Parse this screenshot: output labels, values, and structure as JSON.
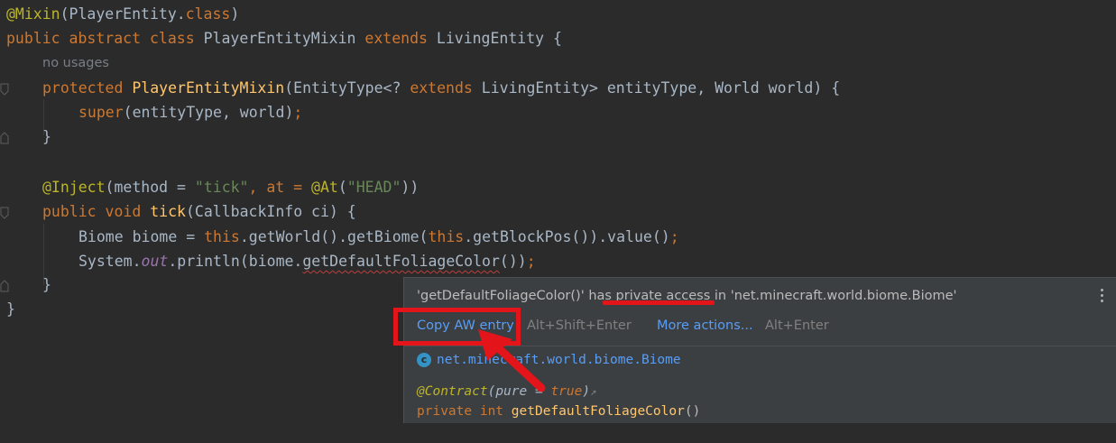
{
  "code": {
    "mixin_annotation": "@Mixin",
    "mixin_arg": "(PlayerEntity.",
    "mixin_class_kw": "class",
    "mixin_close": ")",
    "kw_public": "public",
    "kw_abstract": "abstract",
    "kw_class": "class",
    "class_name": "PlayerEntityMixin",
    "kw_extends": "extends",
    "parent_class": "LivingEntity {",
    "usages_hint": "no usages",
    "kw_protected": "protected",
    "ctor_name": "PlayerEntityMixin",
    "ctor_params_open": "(EntityType<? ",
    "ctor_kw_extends": "extends",
    "ctor_params_rest": " LivingEntity> entityType, World world) {",
    "kw_super": "super",
    "super_args": "(entityType, world)",
    "semicolon": ";",
    "close_brace": "}",
    "inject_annotation": "@Inject",
    "inject_open": "(method = ",
    "inject_method": "\"tick\"",
    "inject_comma": ", at = ",
    "at_annotation": "@At",
    "at_open": "(",
    "at_value": "\"HEAD\"",
    "at_close": "))",
    "kw_public2": "public",
    "kw_void": "void",
    "method_name": "tick",
    "method_params": "(CallbackInfo ci) {",
    "biome_decl": "Biome biome = ",
    "kw_this": "this",
    "get_world": ".getWorld().getBiome(",
    "kw_this2": "this",
    "get_block_pos": ".getBlockPos()).value()",
    "system": "System.",
    "out_field": "out",
    "println_open": ".println(biome.",
    "foliage_call": "getDefaultFoliageColor",
    "println_close": "())",
    "method_close": "}",
    "class_close": "}"
  },
  "popup": {
    "message_prefix": "'getDefaultFoliageColor()' ",
    "message_has": "has private access",
    "message_suffix": " in 'net.minecraft.world.biome.Biome'",
    "action_primary": "Copy AW entry",
    "action_primary_shortcut": "Alt+Shift+Enter",
    "action_more": "More actions...",
    "action_more_shortcut": "Alt+Enter",
    "class_badge": "c",
    "class_fqn": "net.minecraft.world.biome.Biome",
    "contract_annotation": "@Contract",
    "contract_open": "(",
    "contract_param": "pure",
    "contract_eq": " = ",
    "contract_value": "true",
    "contract_close": ")",
    "contract_arrow": "↗",
    "signature_private": "private",
    "signature_int": "int",
    "signature_name": "getDefaultFoliageColor",
    "signature_parens": "()"
  },
  "colors": {
    "editor_bg": "#2b2b2b",
    "popup_bg": "#3c3f41",
    "keyword": "#cc7832",
    "annotation": "#bbb529",
    "function": "#ffc66d",
    "string": "#6a8759",
    "link": "#589df6",
    "highlight_red": "#e3141a"
  }
}
